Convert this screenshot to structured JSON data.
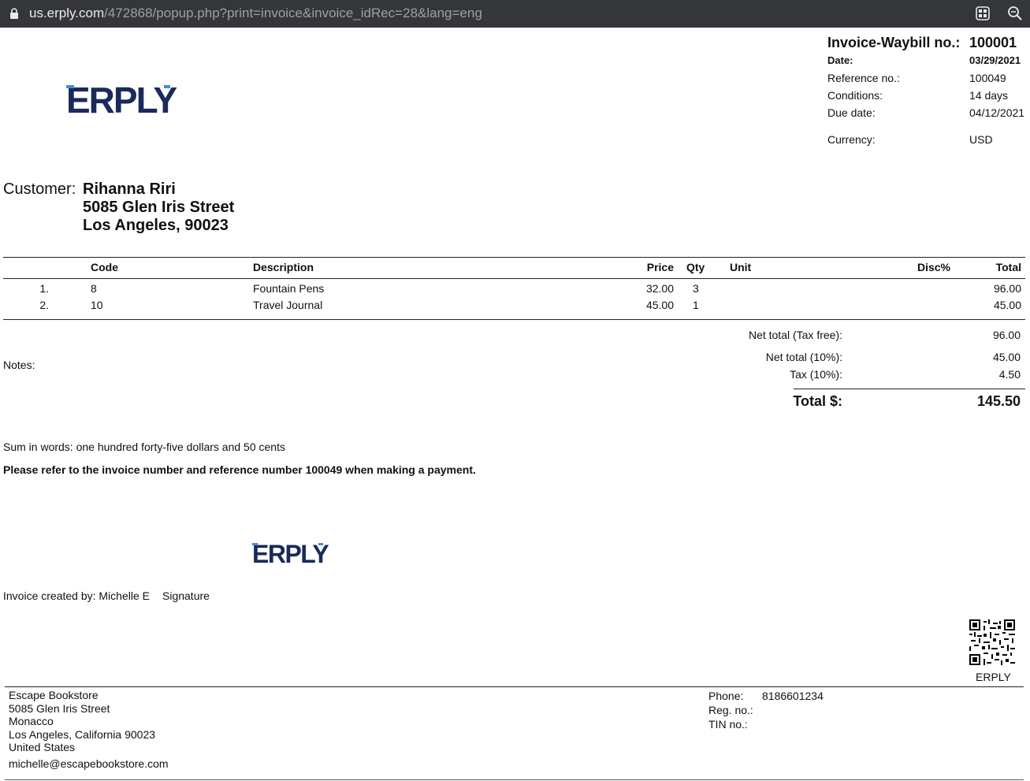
{
  "browser": {
    "url_host": "us.erply.com",
    "url_path": "/472868/popup.php?print=invoice&invoice_idRec=28&lang=eng",
    "icons": [
      "lock-icon",
      "apps-icon",
      "zoom-icon"
    ]
  },
  "brand": {
    "logo_text": "ERPLY",
    "logo_color": "#1a2a5a",
    "logo_accent": "#3c8fe0"
  },
  "invoice": {
    "title_label": "Invoice-Waybill no.:",
    "number": "100001",
    "date_label": "Date:",
    "date": "03/29/2021",
    "reference_label": "Reference no.:",
    "reference": "100049",
    "conditions_label": "Conditions:",
    "conditions": "14 days",
    "due_label": "Due date:",
    "due": "04/12/2021",
    "currency_label": "Currency:",
    "currency": "USD"
  },
  "customer": {
    "label": "Customer:",
    "name": "Rihanna Riri",
    "street": "5085 Glen Iris Street",
    "city": "Los Angeles, 90023"
  },
  "table": {
    "headers": {
      "code": "Code",
      "description": "Description",
      "price": "Price",
      "qty": "Qty",
      "unit": "Unit",
      "disc": "Disc%",
      "total": "Total"
    },
    "rows": [
      {
        "no": "1.",
        "code": "8",
        "description": "Fountain Pens",
        "price": "32.00",
        "qty": "3",
        "unit": "",
        "disc": "",
        "total": "96.00"
      },
      {
        "no": "2.",
        "code": "10",
        "description": "Travel Journal",
        "price": "45.00",
        "qty": "1",
        "unit": "",
        "disc": "",
        "total": "45.00"
      }
    ]
  },
  "totals": {
    "net_free_label": "Net total (Tax free):",
    "net_free": "96.00",
    "net_10_label": "Net total (10%):",
    "net_10": "45.00",
    "tax_10_label": "Tax (10%):",
    "tax_10": "4.50",
    "total_label": "Total $:",
    "total": "145.50"
  },
  "notes_label": "Notes:",
  "sum_in_words": "Sum in words: one hundred forty-five dollars and 50 cents",
  "payment_note": "Please refer to the invoice number and reference number 100049 when making a payment.",
  "created_by": "Invoice created by: Michelle E",
  "signature_label": "Signature",
  "qr_label": "ERPLY",
  "company": {
    "name": "Escape Bookstore",
    "street": "5085 Glen Iris Street",
    "area": "Monacco",
    "city": "Los Angeles, California 90023",
    "country": "United States",
    "email": "michelle@escapebookstore.com",
    "phone_label": "Phone:",
    "phone": "8186601234",
    "reg_label": "Reg. no.:",
    "tin_label": "TIN no.:"
  }
}
